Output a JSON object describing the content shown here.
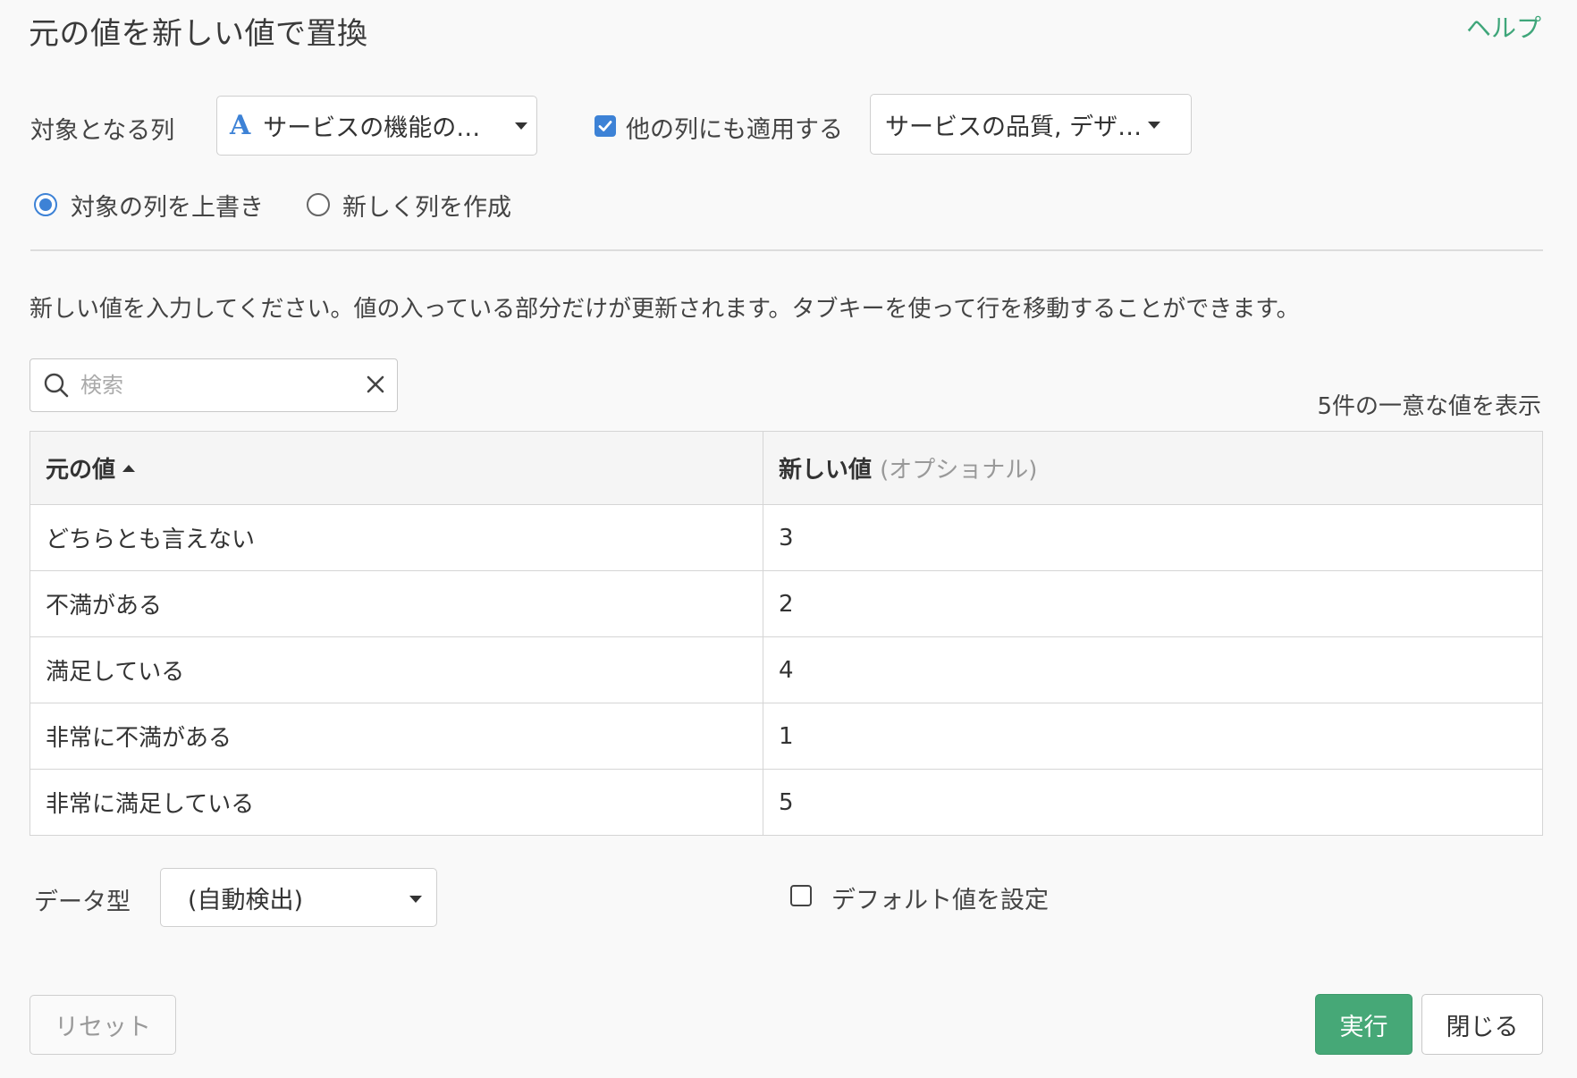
{
  "header": {
    "title": "元の値を新しい値で置換",
    "help_label": "ヘルプ"
  },
  "target": {
    "label": "対象となる列",
    "type_icon_letter": "A",
    "selected_column": "サービスの機能の…",
    "apply_other_checked": true,
    "apply_other_label": "他の列にも適用する",
    "other_columns": "サービスの品質, デザ…"
  },
  "mode": {
    "overwrite_label": "対象の列を上書き",
    "new_column_label": "新しく列を作成",
    "selected": "overwrite"
  },
  "instruction": "新しい値を入力してください。値の入っている部分だけが更新されます。タブキーを使って行を移動することができます。",
  "search": {
    "placeholder": "検索",
    "value": ""
  },
  "count_label": "5件の一意な値を表示",
  "table": {
    "col_original": "元の値",
    "col_new": "新しい値",
    "col_new_hint": "(オプショナル)",
    "rows": [
      {
        "original": "どちらとも言えない",
        "new": "3"
      },
      {
        "original": "不満がある",
        "new": "2"
      },
      {
        "original": "満足している",
        "new": "4"
      },
      {
        "original": "非常に不満がある",
        "new": "1"
      },
      {
        "original": "非常に満足している",
        "new": "5"
      }
    ]
  },
  "data_type": {
    "label": "データ型",
    "selected": "(自動検出)"
  },
  "default_value": {
    "checked": false,
    "label": "デフォルト値を設定"
  },
  "buttons": {
    "reset": "リセット",
    "run": "実行",
    "close": "閉じる"
  },
  "colors": {
    "accent_blue": "#3d82d6",
    "accent_green": "#46a877",
    "help_green": "#3fa67a"
  },
  "icons": {
    "search": "search-icon",
    "clear": "close-icon",
    "dropdown": "caret-down-icon",
    "sort": "caret-up-icon",
    "checkbox": "checkmark-icon"
  }
}
